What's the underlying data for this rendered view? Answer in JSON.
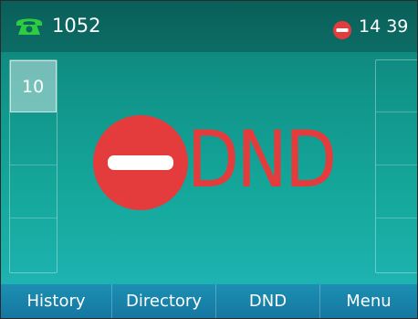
{
  "status": {
    "extension": "1052",
    "time": "14 39",
    "icons": {
      "line": "phone-handset-icon",
      "dnd_indicator": "dnd-icon"
    }
  },
  "line_keys": {
    "left": [
      {
        "label": "10",
        "active": true
      },
      {
        "label": ""
      },
      {
        "label": ""
      },
      {
        "label": ""
      }
    ],
    "right": [
      {
        "label": ""
      },
      {
        "label": ""
      },
      {
        "label": ""
      },
      {
        "label": ""
      }
    ]
  },
  "main": {
    "dnd_text": "DND",
    "dnd_color": "#e43c3c"
  },
  "softkeys": [
    {
      "label": "History"
    },
    {
      "label": "Directory"
    },
    {
      "label": "DND"
    },
    {
      "label": "Menu"
    }
  ],
  "colors": {
    "phone_icon": "#2ecc40",
    "dnd_red": "#e43c3c"
  }
}
